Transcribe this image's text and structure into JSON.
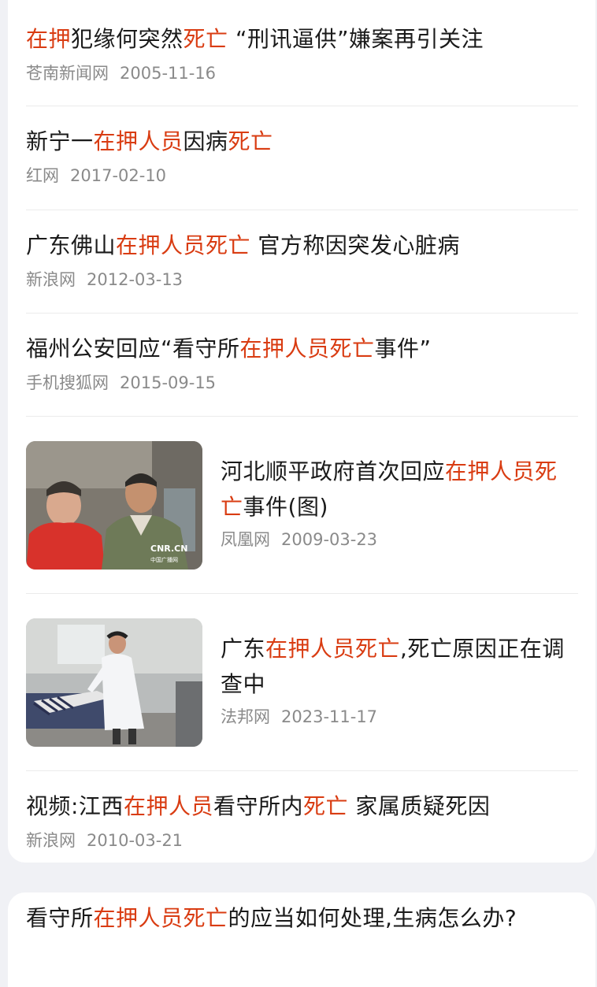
{
  "articles": [
    {
      "title_parts": [
        {
          "t": "在押",
          "hl": true
        },
        {
          "t": "犯缘何突然",
          "hl": false
        },
        {
          "t": "死亡",
          "hl": true
        },
        {
          "t": " “刑讯逼供”嫌案再引关注",
          "hl": false
        }
      ],
      "source": "苍南新闻网",
      "date": "2005-11-16"
    },
    {
      "title_parts": [
        {
          "t": "新宁一",
          "hl": false
        },
        {
          "t": "在押人员",
          "hl": true
        },
        {
          "t": "因病",
          "hl": false
        },
        {
          "t": "死亡",
          "hl": true
        }
      ],
      "source": "红网",
      "date": "2017-02-10"
    },
    {
      "title_parts": [
        {
          "t": "广东佛山",
          "hl": false
        },
        {
          "t": "在押人员死亡",
          "hl": true
        },
        {
          "t": " 官方称因突发心脏病",
          "hl": false
        }
      ],
      "source": "新浪网",
      "date": "2012-03-13"
    },
    {
      "title_parts": [
        {
          "t": "福州公安回应“看守所",
          "hl": false
        },
        {
          "t": "在押人员死亡",
          "hl": true
        },
        {
          "t": "事件”",
          "hl": false
        }
      ],
      "source": "手机搜狐网",
      "date": "2015-09-15"
    },
    {
      "title_parts": [
        {
          "t": "河北顺平政府首次回应",
          "hl": false
        },
        {
          "t": "在押人员死亡",
          "hl": true
        },
        {
          "t": "事件(图)",
          "hl": false
        }
      ],
      "source": "凤凰网",
      "date": "2009-03-23",
      "thumb_logo": "CNR.CN",
      "thumb_logo_sub": "中国广播网"
    },
    {
      "title_parts": [
        {
          "t": "广东",
          "hl": false
        },
        {
          "t": "在押人员死亡",
          "hl": true
        },
        {
          "t": ",死亡原因正在调查中",
          "hl": false
        }
      ],
      "source": "法邦网",
      "date": "2023-11-17"
    },
    {
      "title_parts": [
        {
          "t": "视频:江西",
          "hl": false
        },
        {
          "t": "在押人员",
          "hl": true
        },
        {
          "t": "看守所内",
          "hl": false
        },
        {
          "t": "死亡",
          "hl": true
        },
        {
          "t": " 家属质疑死因",
          "hl": false
        }
      ],
      "source": "新浪网",
      "date": "2010-03-21"
    }
  ],
  "next_card": {
    "title_parts": [
      {
        "t": "看守所",
        "hl": false
      },
      {
        "t": "在押人员死亡",
        "hl": true
      },
      {
        "t": "的应当如何处理,生病怎么办?",
        "hl": false
      }
    ]
  },
  "colors": {
    "highlight": "#d93c12",
    "title": "#1a1a1a",
    "meta": "#8a8a8a",
    "background": "#f0f1f5"
  }
}
